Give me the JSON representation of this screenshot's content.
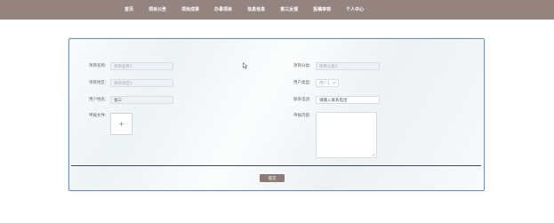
{
  "nav": {
    "items": [
      {
        "label": "首页"
      },
      {
        "label": "项目公告"
      },
      {
        "label": "项目成果"
      },
      {
        "label": "办事项目"
      },
      {
        "label": "信息信息"
      },
      {
        "label": "第三反馈"
      },
      {
        "label": "投稿审核"
      },
      {
        "label": "个人中心"
      }
    ]
  },
  "form": {
    "project_name_label": "项目名称:",
    "project_name_placeholder": "项目名称1",
    "project_category_label": "项目分类:",
    "project_category_placeholder": "项目分类1",
    "project_area_label": "项目地区:",
    "project_area_placeholder": "项目地区1",
    "user_type_label": "用户类型:",
    "user_type_value": "用户1",
    "user_name_label": "用户姓名:",
    "user_name_value": "张三",
    "contact_phone_label": "联系电话:",
    "contact_phone_placeholder": "请输入联系电话",
    "upload_label": "申报文件:",
    "upload_plus": "+",
    "content_label": "申报内容:",
    "submit_label": "提交"
  },
  "icons": {
    "cursor": "mouse-cursor-icon",
    "select_arrow": "chevron-down-icon",
    "resize": "resize-handle-icon",
    "upload": "plus-icon"
  },
  "colors": {
    "topbar": "#958380",
    "card_border": "#6f8fb3",
    "divider": "#3d4a5a",
    "submit": "#8b7b78"
  }
}
